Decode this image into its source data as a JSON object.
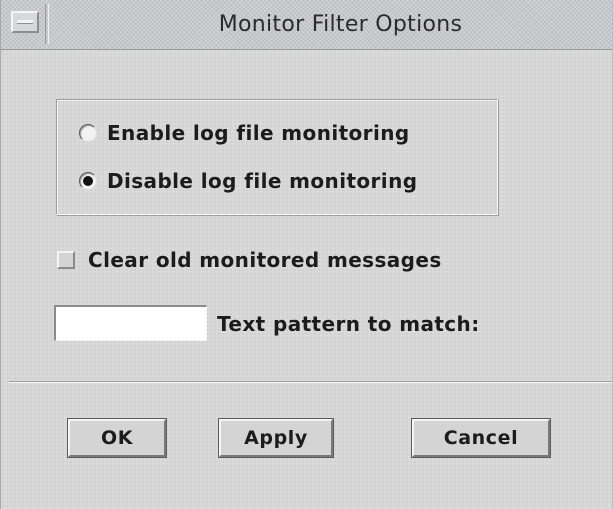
{
  "window": {
    "title": "Monitor Filter Options"
  },
  "monitoring_options": [
    {
      "label": "Enable log file monitoring",
      "selected": false
    },
    {
      "label": "Disable log file monitoring",
      "selected": true
    }
  ],
  "clear_messages": {
    "label": "Clear old monitored messages",
    "checked": false
  },
  "text_pattern": {
    "label": "Text pattern to match:",
    "value": ""
  },
  "buttons": {
    "ok": "OK",
    "apply": "Apply",
    "cancel": "Cancel"
  },
  "icons": {
    "window_menu": "window-menu-icon"
  }
}
